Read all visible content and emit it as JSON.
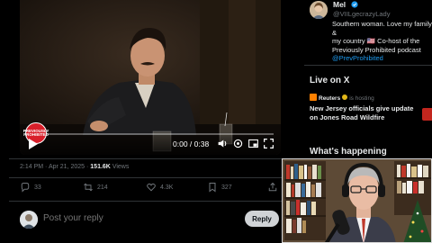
{
  "video": {
    "time": "0:00 / 0:38",
    "brand_badge": "PREVIOUSLY PROHIBITED",
    "progress": 0.0
  },
  "post": {
    "time": "2:14 PM",
    "separator": "·",
    "date": "Apr 21, 2025",
    "separator2": "·",
    "views_count": "151.6K",
    "views_label": "Views"
  },
  "actions": {
    "replies": "33",
    "reposts": "214",
    "likes": "4.3K",
    "bookmarks": "327"
  },
  "reply": {
    "placeholder": "Post your reply",
    "button_label": "Reply"
  },
  "profile": {
    "name": "Mel",
    "handle": "@VIILgecrazyLady",
    "bio_line1": "Southern woman. Love my family &",
    "bio_line2": "my country 🇺🇸 Co-host of the",
    "bio_line3": "Previously Prohibited podcast",
    "bio_link": "@PrevProhibited"
  },
  "live": {
    "title": "Live on X",
    "host_name": "Reuters",
    "host_status": "is hosting",
    "headline": "New Jersey officials give update on Jones Road Wildfire"
  },
  "trending": {
    "title": "What's happening"
  },
  "colors": {
    "background": "#000000",
    "text_primary": "#e7e9ea",
    "text_secondary": "#71767b",
    "link": "#1d9bf0",
    "divider": "#2f3336",
    "reply_button_bg": "#d0d3d6",
    "brand_red": "#d91f2a"
  },
  "icons": {
    "reply": "speech-bubble-icon",
    "repost": "repost-arrows-icon",
    "like": "heart-icon",
    "bookmark": "bookmark-icon",
    "share": "share-upload-icon",
    "play": "play-icon",
    "volume": "volume-icon",
    "settings": "gear-icon",
    "fullscreen": "fullscreen-icon"
  }
}
